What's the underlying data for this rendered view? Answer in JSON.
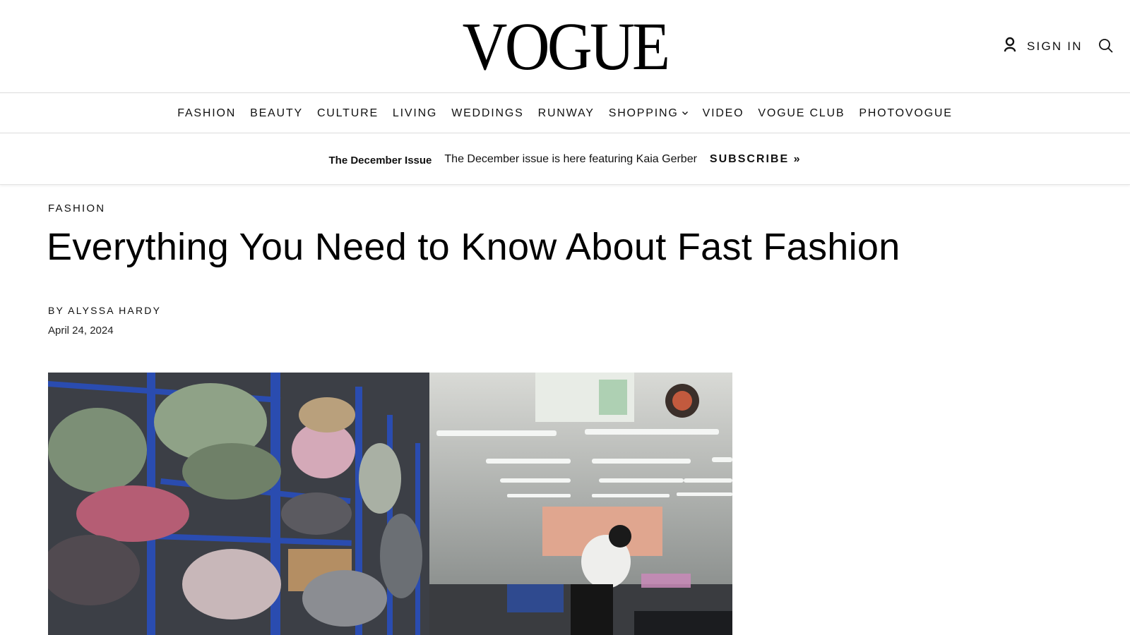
{
  "brand": {
    "logo_text": "VOGUE"
  },
  "header": {
    "signin_label": "SIGN IN",
    "user_icon": "user-icon",
    "search_icon": "search-icon"
  },
  "nav": {
    "items": [
      {
        "label": "FASHION"
      },
      {
        "label": "BEAUTY"
      },
      {
        "label": "CULTURE"
      },
      {
        "label": "LIVING"
      },
      {
        "label": "WEDDINGS"
      },
      {
        "label": "RUNWAY"
      },
      {
        "label": "SHOPPING",
        "has_dropdown": true
      },
      {
        "label": "VIDEO"
      },
      {
        "label": "VOGUE CLUB"
      },
      {
        "label": "PHOTOVOGUE"
      }
    ]
  },
  "promo": {
    "label": "The December Issue",
    "text": "The December issue is here featuring Kaia Gerber",
    "cta": "SUBSCRIBE »"
  },
  "article": {
    "rubric": "FASHION",
    "headline": "Everything You Need to Know About Fast Fashion",
    "byline_prefix": "BY",
    "author": "ALYSSA HARDY",
    "date": "April 24, 2024"
  },
  "colors": {
    "text": "#111111",
    "divider": "#dcdcdc",
    "background": "#ffffff"
  }
}
